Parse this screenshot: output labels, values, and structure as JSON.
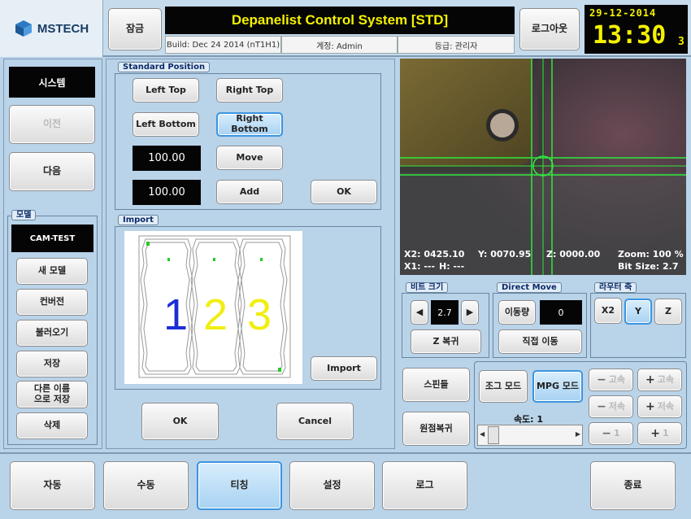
{
  "header": {
    "brand": "MSTECH",
    "lock_label": "잠금",
    "title": "Depanelist Control System [STD]",
    "build": "Build: Dec 24 2014 (nT1H1)",
    "account": "계정: Admin",
    "grade": "등급: 관리자",
    "logout_label": "로그아웃",
    "date": "29-12-2014",
    "time": "13:30",
    "seconds": "3"
  },
  "left": {
    "system_label": "시스템",
    "prev_label": "이전",
    "next_label": "다음",
    "model_legend": "모델",
    "model_name": "CAM-TEST",
    "model_buttons": [
      "새 모델",
      "컨버전",
      "불러오기",
      "저장",
      "다른 이름\n으로 저장",
      "삭제"
    ]
  },
  "standard_position": {
    "legend": "Standard Position",
    "left_top": "Left Top",
    "right_top": "Right Top",
    "left_bottom": "Left Bottom",
    "right_bottom": "Right Bottom",
    "value1": "100.00",
    "value2": "100.00",
    "move": "Move",
    "add": "Add",
    "ok": "OK"
  },
  "import": {
    "legend": "Import",
    "numbers": [
      "1",
      "2",
      "3"
    ],
    "number_colors": [
      "#1a2fd6",
      "#f1ee10",
      "#f1ee10"
    ],
    "import_label": "Import"
  },
  "center_bottom": {
    "ok": "OK",
    "cancel": "Cancel"
  },
  "camera": {
    "x2": "X2: 0425.10",
    "y": "Y: 0070.95",
    "z": "Z: 0000.00",
    "zoom": "Zoom: 100 %",
    "x1": "X1: ---",
    "h": "H: ---",
    "bit_size": "Bit Size: 2.7"
  },
  "bit": {
    "legend": "비트 크기",
    "value": "2.7",
    "z_reset": "Z 복귀"
  },
  "direct_move": {
    "legend": "Direct Move",
    "amount_label": "이동량",
    "amount": "0",
    "direct_label": "직접 이동"
  },
  "router_axis": {
    "legend": "라우터 축",
    "x2": "X2",
    "y": "Y",
    "z": "Z"
  },
  "spindle": {
    "spindle": "스핀들",
    "origin": "원점복귀"
  },
  "jog": {
    "jog_mode": "조그 모드",
    "mpg_mode": "MPG 모드",
    "speed_label": "속도: 1",
    "minus_fast": "고속",
    "plus_fast": "고속",
    "minus_slow": "저속",
    "plus_slow": "저속",
    "minus_one": "1",
    "plus_one": "1"
  },
  "footer": {
    "tabs": [
      "자동",
      "수동",
      "티칭",
      "설정",
      "로그"
    ],
    "active_tab": "티칭",
    "exit": "종료"
  }
}
